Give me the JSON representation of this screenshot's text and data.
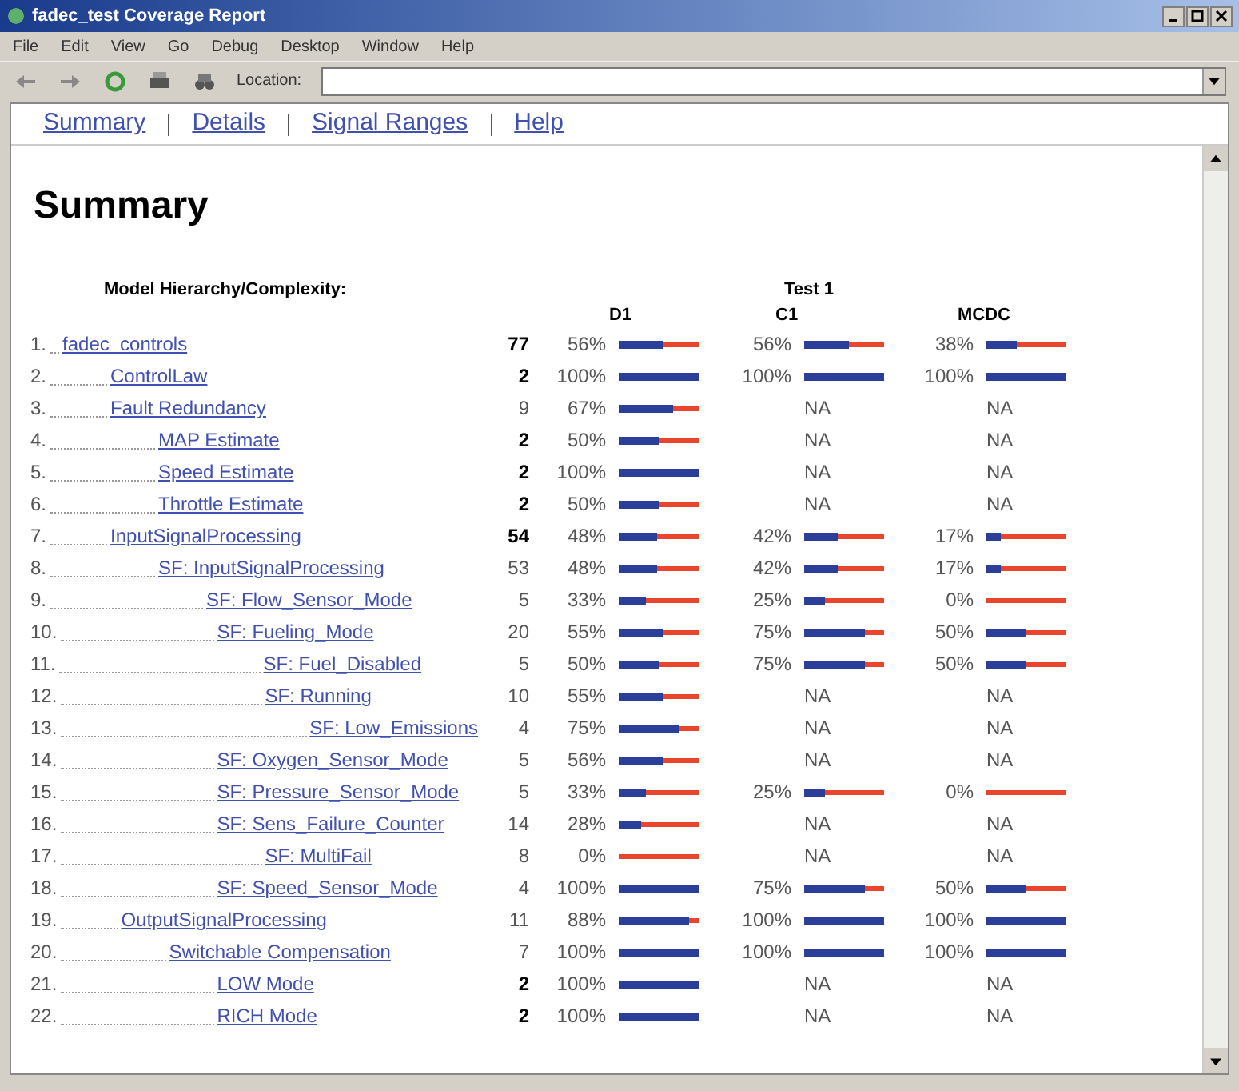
{
  "window": {
    "title": "fadec_test Coverage Report"
  },
  "menu": [
    "File",
    "Edit",
    "View",
    "Go",
    "Debug",
    "Desktop",
    "Window",
    "Help"
  ],
  "toolbar": {
    "location_label": "Location:"
  },
  "nav_links": [
    "Summary",
    "Details",
    "Signal Ranges",
    "Help"
  ],
  "heading": "Summary",
  "table": {
    "hierarchy_header": "Model Hierarchy/Complexity:",
    "test_header": "Test 1",
    "columns": [
      "D1",
      "C1",
      "MCDC"
    ],
    "rows": [
      {
        "number": "1.",
        "name": "fadec_controls",
        "complexity": "77",
        "bold": true,
        "metrics": [
          {
            "value": "56%",
            "level": 0.56
          },
          {
            "value": "56%",
            "level": 0.56
          },
          {
            "value": "38%",
            "level": 0.38
          }
        ],
        "children": [
          {
            "number": "2.",
            "name": "ControlLaw",
            "complexity": "2",
            "bold": true,
            "metrics": [
              {
                "value": "100%",
                "level": 1
              },
              {
                "value": "100%",
                "level": 1
              },
              {
                "value": "100%",
                "level": 1
              }
            ]
          },
          {
            "number": "3.",
            "name": "Fault Redundancy",
            "complexity": "9",
            "bold": false,
            "metrics": [
              {
                "value": "67%",
                "level": 0.67
              },
              {
                "value": "NA"
              },
              {
                "value": "NA"
              }
            ],
            "children": [
              {
                "number": "4.",
                "name": "MAP Estimate",
                "complexity": "2",
                "bold": true,
                "metrics": [
                  {
                    "value": "50%",
                    "level": 0.5
                  },
                  {
                    "value": "NA"
                  },
                  {
                    "value": "NA"
                  }
                ]
              },
              {
                "number": "5.",
                "name": "Speed Estimate",
                "complexity": "2",
                "bold": true,
                "metrics": [
                  {
                    "value": "100%",
                    "level": 1
                  },
                  {
                    "value": "NA"
                  },
                  {
                    "value": "NA"
                  }
                ]
              },
              {
                "number": "6.",
                "name": "Throttle Estimate",
                "complexity": "2",
                "bold": true,
                "metrics": [
                  {
                    "value": "50%",
                    "level": 0.5
                  },
                  {
                    "value": "NA"
                  },
                  {
                    "value": "NA"
                  }
                ]
              }
            ]
          },
          {
            "number": "7.",
            "name": "InputSignalProcessing",
            "complexity": "54",
            "bold": true,
            "metrics": [
              {
                "value": "48%",
                "level": 0.48
              },
              {
                "value": "42%",
                "level": 0.42
              },
              {
                "value": "17%",
                "level": 0.17
              }
            ],
            "children": [
              {
                "number": "8.",
                "name": "SF: InputSignalProcessing",
                "complexity": "53",
                "bold": false,
                "metrics": [
                  {
                    "value": "48%",
                    "level": 0.48
                  },
                  {
                    "value": "42%",
                    "level": 0.42
                  },
                  {
                    "value": "17%",
                    "level": 0.17
                  }
                ],
                "children": [
                  {
                    "number": "9.",
                    "name": "SF: Flow_Sensor_Mode",
                    "complexity": "5",
                    "bold": false,
                    "metrics": [
                      {
                        "value": "33%",
                        "level": 0.33
                      },
                      {
                        "value": "25%",
                        "level": 0.25
                      },
                      {
                        "value": "0%",
                        "level": 0
                      }
                    ]
                  },
                  {
                    "number": "10.",
                    "name": "SF: Fueling_Mode",
                    "complexity": "20",
                    "bold": false,
                    "metrics": [
                      {
                        "value": "55%",
                        "level": 0.55
                      },
                      {
                        "value": "75%",
                        "level": 0.75
                      },
                      {
                        "value": "50%",
                        "level": 0.5
                      }
                    ],
                    "children": [
                      {
                        "number": "11.",
                        "name": "SF: Fuel_Disabled",
                        "complexity": "5",
                        "bold": false,
                        "metrics": [
                          {
                            "value": "50%",
                            "level": 0.5
                          },
                          {
                            "value": "75%",
                            "level": 0.75
                          },
                          {
                            "value": "50%",
                            "level": 0.5
                          }
                        ]
                      },
                      {
                        "number": "12.",
                        "name": "SF: Running",
                        "complexity": "10",
                        "bold": false,
                        "metrics": [
                          {
                            "value": "55%",
                            "level": 0.55
                          },
                          {
                            "value": "NA"
                          },
                          {
                            "value": "NA"
                          }
                        ],
                        "children": [
                          {
                            "number": "13.",
                            "name": "SF: Low_Emissions",
                            "complexity": "4",
                            "bold": false,
                            "metrics": [
                              {
                                "value": "75%",
                                "level": 0.75
                              },
                              {
                                "value": "NA"
                              },
                              {
                                "value": "NA"
                              }
                            ]
                          }
                        ]
                      }
                    ]
                  },
                  {
                    "number": "14.",
                    "name": "SF: Oxygen_Sensor_Mode",
                    "complexity": "5",
                    "bold": false,
                    "metrics": [
                      {
                        "value": "56%",
                        "level": 0.56
                      },
                      {
                        "value": "NA"
                      },
                      {
                        "value": "NA"
                      }
                    ]
                  },
                  {
                    "number": "15.",
                    "name": "SF: Pressure_Sensor_Mode",
                    "complexity": "5",
                    "bold": false,
                    "metrics": [
                      {
                        "value": "33%",
                        "level": 0.33
                      },
                      {
                        "value": "25%",
                        "level": 0.25
                      },
                      {
                        "value": "0%",
                        "level": 0
                      }
                    ]
                  },
                  {
                    "number": "16.",
                    "name": "SF: Sens_Failure_Counter",
                    "complexity": "14",
                    "bold": false,
                    "metrics": [
                      {
                        "value": "28%",
                        "level": 0.28
                      },
                      {
                        "value": "NA"
                      },
                      {
                        "value": "NA"
                      }
                    ],
                    "children": [
                      {
                        "number": "17.",
                        "name": "SF: MultiFail",
                        "complexity": "8",
                        "bold": false,
                        "metrics": [
                          {
                            "value": "0%",
                            "level": 0
                          },
                          {
                            "value": "NA"
                          },
                          {
                            "value": "NA"
                          }
                        ]
                      }
                    ]
                  },
                  {
                    "number": "18.",
                    "name": "SF: Speed_Sensor_Mode",
                    "complexity": "4",
                    "bold": false,
                    "metrics": [
                      {
                        "value": "100%",
                        "level": 1
                      },
                      {
                        "value": "75%",
                        "level": 0.75
                      },
                      {
                        "value": "50%",
                        "level": 0.5
                      }
                    ]
                  }
                ]
              }
            ]
          },
          {
            "number": "19.",
            "name": "OutputSignalProcessing",
            "complexity": "11",
            "bold": false,
            "metrics": [
              {
                "value": "88%",
                "level": 0.88
              },
              {
                "value": "100%",
                "level": 1
              },
              {
                "value": "100%",
                "level": 1
              }
            ],
            "children": [
              {
                "number": "20.",
                "name": "Switchable Compensation",
                "complexity": "7",
                "bold": false,
                "metrics": [
                  {
                    "value": "100%",
                    "level": 1
                  },
                  {
                    "value": "100%",
                    "level": 1
                  },
                  {
                    "value": "100%",
                    "level": 1
                  }
                ],
                "children": [
                  {
                    "number": "21.",
                    "name": "LOW Mode",
                    "complexity": "2",
                    "bold": true,
                    "metrics": [
                      {
                        "value": "100%",
                        "level": 1
                      },
                      {
                        "value": "NA"
                      },
                      {
                        "value": "NA"
                      }
                    ]
                  },
                  {
                    "number": "22.",
                    "name": "RICH Mode",
                    "complexity": "2",
                    "bold": true,
                    "metrics": [
                      {
                        "value": "100%",
                        "level": 1
                      },
                      {
                        "value": "NA"
                      },
                      {
                        "value": "NA"
                      }
                    ]
                  }
                ]
              }
            ]
          }
        ]
      }
    ]
  }
}
